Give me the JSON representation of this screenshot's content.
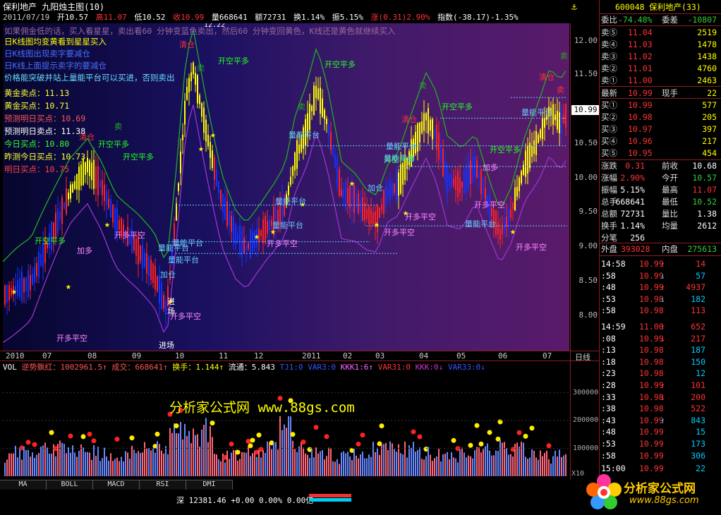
{
  "title": {
    "stock": "保利地产",
    "indicator": "九阳烛主图(10)",
    "date": "2011/07/19",
    "open": "开10.57",
    "high": "高11.07",
    "low": "低10.52",
    "close": "收10.99",
    "amount_qty": "量668641",
    "amount_money": "额72731",
    "turnover": "换1.14%",
    "swing": "振5.15%",
    "change": "涨(0.31)2.90%",
    "index": "指数(-38.17)-1.35%"
  },
  "tip": "如果佣金低的话，买入看星星，卖出看60 分钟变蓝色卖出，然后60 分钟变回黄色，K线还是黄色就继续买入",
  "notes": [
    {
      "text": "日K线图均变黄看到星星买入",
      "color": "#ffff00"
    },
    {
      "text": "日K线图出现卖字要减仓",
      "color": "#4a6cff"
    },
    {
      "text": "日K线上面提示卖字的要减仓",
      "color": "#4a6cff"
    },
    {
      "text": "价格能突破并站上量能平台可以买进，否则卖出",
      "color": "#66ddff"
    }
  ],
  "levels": [
    {
      "label": "黄金卖点：",
      "value": "11.13",
      "color": "#ffff33"
    },
    {
      "label": "黄金买点：",
      "value": "10.71",
      "color": "#ffff33"
    },
    {
      "label": "预测明日买点：",
      "value": "10.69",
      "color": "#ff5555"
    },
    {
      "label": "预测明日卖点：",
      "value": "11.38",
      "color": "#ffffff"
    },
    {
      "label": "今日买点：",
      "value": "10.80",
      "color": "#33ff33"
    },
    {
      "label": "昨测今日买点：",
      "value": "10.73",
      "color": "#ffff33"
    },
    {
      "label": "明日买点：",
      "value": "10.75",
      "color": "#ff4444"
    }
  ],
  "chart_labels": {
    "qingcang": "清仓",
    "kai_kong_ping_duo": "开空平多",
    "kai_duo_ping_kong": "开多平空",
    "liangneng": "量能平台",
    "mai": "卖",
    "jiacang": "加仓",
    "jiaduo": "加多",
    "jinchang": "进场",
    "low_label": "12.22"
  },
  "current_price": "10.99",
  "yticks": [
    "12.00",
    "11.50",
    "11.00",
    "10.50",
    "10.00",
    "9.50",
    "9.00",
    "8.50",
    "8.00"
  ],
  "xlabels": [
    "2010",
    "07",
    "08",
    "09",
    "10",
    "11",
    "12",
    "2011",
    "02",
    "03",
    "04",
    "05",
    "06",
    "07"
  ],
  "period": "日线",
  "vol_header": {
    "name": "VOL",
    "trend": "逆势飘红：1002961.5↑",
    "volume": "成交：668641↑",
    "turnover": "换手：1.144↑",
    "float": "流通：5.843",
    "tj": "TJ1:0",
    "var3": "VAR3:0",
    "kkk1": "KKK1:6↑",
    "var31": "VAR31:0",
    "kkk": "KKK:0↓",
    "var33": "VAR33:0↓"
  },
  "vol_ticks": [
    "300000",
    "200000",
    "100000"
  ],
  "vol_unit": "X10",
  "watermark": "分析家公式网 www.88gs.com",
  "tabs": [
    "MA",
    "BOLL",
    "MACD",
    "RSI",
    "DMI"
  ],
  "status": {
    "market": "深",
    "value": "12381.46",
    "change": "+0.00",
    "pct": "0.00%",
    "amount": "0.00亿"
  },
  "quote": {
    "code": "600048",
    "name": "保利地产(33)",
    "weibi_label": "委比",
    "weibi": "-74.48%",
    "weicha_label": "委差",
    "weicha": "-10807",
    "asks": [
      {
        "label": "卖⑤",
        "price": "11.04",
        "vol": "2519"
      },
      {
        "label": "卖④",
        "price": "11.03",
        "vol": "1478"
      },
      {
        "label": "卖③",
        "price": "11.02",
        "vol": "1438"
      },
      {
        "label": "卖②",
        "price": "11.01",
        "vol": "4760"
      },
      {
        "label": "卖①",
        "price": "11.00",
        "vol": "2463"
      }
    ],
    "latest_label": "最新",
    "latest": "10.99",
    "hand_label": "现手",
    "hand": "22",
    "bids": [
      {
        "label": "买①",
        "price": "10.99",
        "vol": "577"
      },
      {
        "label": "买②",
        "price": "10.98",
        "vol": "205"
      },
      {
        "label": "买③",
        "price": "10.97",
        "vol": "397"
      },
      {
        "label": "买④",
        "price": "10.96",
        "vol": "217"
      },
      {
        "label": "买⑤",
        "price": "10.95",
        "vol": "454"
      }
    ],
    "stats": [
      {
        "l1": "涨跌",
        "v1": "0.31",
        "c1": "red",
        "l2": "前收",
        "v2": "10.68",
        "c2": "wht"
      },
      {
        "l1": "涨幅",
        "v1": "2.90%",
        "c1": "red",
        "l2": "今开",
        "v2": "10.57",
        "c2": "grn"
      },
      {
        "l1": "振幅",
        "v1": "5.15%",
        "c1": "wht",
        "l2": "最高",
        "v2": "11.07",
        "c2": "red"
      },
      {
        "l1": "总手",
        "v1": "668641",
        "c1": "wht",
        "l2": "最低",
        "v2": "10.52",
        "c2": "grn"
      },
      {
        "l1": "总额",
        "v1": "72731",
        "c1": "wht",
        "l2": "量比",
        "v2": "1.38",
        "c2": "wht"
      },
      {
        "l1": "换手",
        "v1": "1.14%",
        "c1": "wht",
        "l2": "均量",
        "v2": "2612",
        "c2": "wht"
      },
      {
        "l1": "分笔",
        "v1": "256",
        "c1": "wht",
        "l2": "",
        "v2": "",
        "c2": "wht"
      }
    ],
    "waipan_label": "外盘",
    "waipan": "393028",
    "neipan_label": "内盘",
    "neipan": "275613",
    "ticks": [
      {
        "t": "14:58",
        "p": "10.99",
        "a": "↑",
        "v": "14",
        "c": "red"
      },
      {
        "t": ":58",
        "p": "10.99",
        "a": "↓",
        "v": "57",
        "c": "cyan"
      },
      {
        "t": ":48",
        "p": "10.99",
        "a": "↑",
        "v": "4937",
        "c": "red"
      },
      {
        "t": ":53",
        "p": "10.98",
        "a": "↓",
        "v": "182",
        "c": "cyan"
      },
      {
        "t": ":58",
        "p": "10.98",
        "a": "",
        "v": "113",
        "c": "red"
      },
      {
        "t": "14:59",
        "p": "11.00",
        "a": "↑",
        "v": "652",
        "c": "red"
      },
      {
        "t": ":08",
        "p": "10.99",
        "a": "↓",
        "v": "217",
        "c": "red"
      },
      {
        "t": ":13",
        "p": "10.98",
        "a": "",
        "v": "187",
        "c": "cyan"
      },
      {
        "t": ":18",
        "p": "10.98",
        "a": "",
        "v": "150",
        "c": "cyan"
      },
      {
        "t": ":23",
        "p": "10.98",
        "a": "",
        "v": "12",
        "c": "cyan"
      },
      {
        "t": ":28",
        "p": "10.99",
        "a": "↑",
        "v": "101",
        "c": "red"
      },
      {
        "t": ":33",
        "p": "10.98",
        "a": "↓",
        "v": "200",
        "c": "red"
      },
      {
        "t": ":38",
        "p": "10.98",
        "a": "",
        "v": "522",
        "c": "red"
      },
      {
        "t": ":43",
        "p": "10.99",
        "a": "↑",
        "v": "843",
        "c": "cyan"
      },
      {
        "t": ":48",
        "p": "10.99",
        "a": "",
        "v": "15",
        "c": "cyan"
      },
      {
        "t": ":53",
        "p": "10.99",
        "a": "",
        "v": "173",
        "c": "cyan"
      },
      {
        "t": ":58",
        "p": "10.99",
        "a": "",
        "v": "306",
        "c": "cyan"
      },
      {
        "t": "15:00",
        "p": "10.99",
        "a": "",
        "v": "22",
        "c": "cyan"
      }
    ]
  },
  "logo_text": "分析家公式网",
  "logo_url": "www.88gs.com",
  "colors": {
    "up": "#ff3333",
    "down": "#0033ff",
    "yellow": "#ffff00",
    "green": "#22aa22",
    "purple": "#9933cc"
  }
}
